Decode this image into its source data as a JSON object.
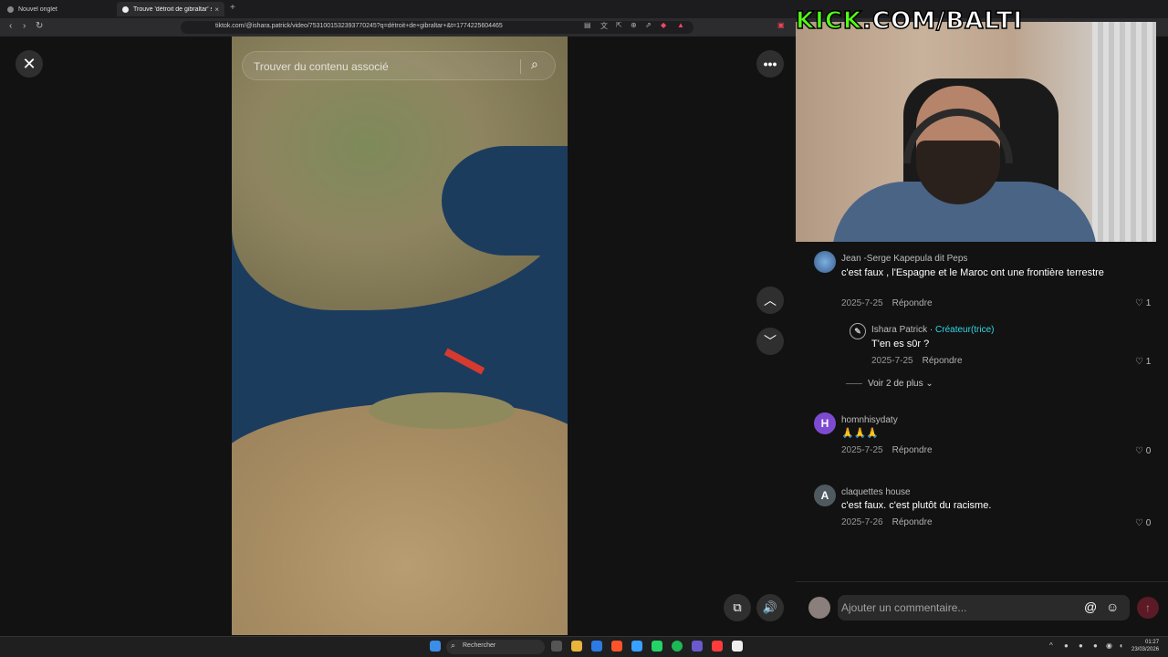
{
  "browser": {
    "tabs": [
      {
        "label": "Nouvel onglet",
        "close": ""
      },
      {
        "label": "Trouve 'détroit de gibraltar' s",
        "close": "×"
      }
    ],
    "new_tab": "+",
    "url": "tiktok.com/@ishara.patrick/video/7531001532393770245?q=détroit+de+gibraltar+&t=1774225604465"
  },
  "overlay": {
    "kick_prefix": "KICK",
    "kick_suffix": ".COM/BALTI"
  },
  "video": {
    "search_placeholder": "Trouver du contenu associé"
  },
  "comments": [
    {
      "user": "Jean -Serge Kapepula dit Peps",
      "text": "c'est faux , l'Espagne et le Maroc ont une frontière terrestre",
      "date": "2025-7-25",
      "reply": "Répondre",
      "likes": "1"
    },
    {
      "user": "Ishara Patrick",
      "badge": "Créateur(trice)",
      "sep": " · ",
      "text": "T'en es s0r ?",
      "date": "2025-7-25",
      "reply": "Répondre",
      "likes": "1"
    },
    {
      "user": "homnhisydaty",
      "avatar": "H",
      "text": "🙏🙏🙏",
      "date": "2025-7-25",
      "reply": "Répondre",
      "likes": "0"
    },
    {
      "user": "claquettes house",
      "avatar": "A",
      "text": "c'est faux. c'est plutôt du racisme.",
      "date": "2025-7-26",
      "reply": "Répondre",
      "likes": "0"
    }
  ],
  "view_more": "Voir 2 de plus",
  "comment_input": {
    "placeholder": "Ajouter un commentaire..."
  },
  "taskbar": {
    "search_placeholder": "Rechercher",
    "time": "01:27",
    "date": "23/03/2026"
  },
  "colors": {
    "accent": "#fe2c55",
    "creator": "#2fd7e6",
    "kick_green": "#53fc18"
  }
}
